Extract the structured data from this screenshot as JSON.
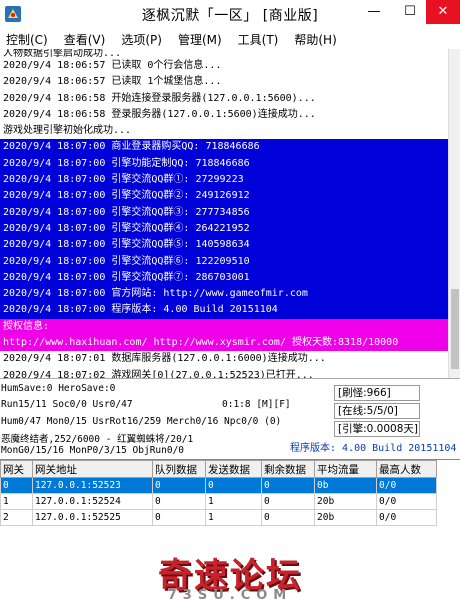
{
  "window": {
    "title": "逐枫沉默「一区」 [商业版]",
    "minimize_label": "—",
    "maximize_label": "☐",
    "close_label": "✕"
  },
  "menu": [
    "控制(C)",
    "查看(V)",
    "选项(P)",
    "管理(M)",
    "工具(T)",
    "帮助(H)"
  ],
  "log": {
    "top_cut": "人物数据引擎启动成功...",
    "lines": [
      {
        "text": "2020/9/4 18:06:57 已读取 0个行会信息...",
        "style": ""
      },
      {
        "text": "2020/9/4 18:06:57 已读取 1个城堡信息...",
        "style": ""
      },
      {
        "text": "2020/9/4 18:06:58 开始连接登录服务器(127.0.0.1:5600)...",
        "style": ""
      },
      {
        "text": "2020/9/4 18:06:58 登录服务器(127.0.0.1:5600)连接成功...",
        "style": ""
      },
      {
        "text": "游戏处理引擎初始化成功...",
        "style": ""
      },
      {
        "text": "2020/9/4 18:07:00 商业登录器购买QQ: 718846686",
        "style": "hl"
      },
      {
        "text": "2020/9/4 18:07:00 引擎功能定制QQ: 718846686",
        "style": "hl"
      },
      {
        "text": "2020/9/4 18:07:00 引擎交流QQ群①: 27299223",
        "style": "hl"
      },
      {
        "text": "2020/9/4 18:07:00 引擎交流QQ群②: 249126912",
        "style": "hl"
      },
      {
        "text": "2020/9/4 18:07:00 引擎交流QQ群③: 277734856",
        "style": "hl"
      },
      {
        "text": "2020/9/4 18:07:00 引擎交流QQ群④: 264221952",
        "style": "hl"
      },
      {
        "text": "2020/9/4 18:07:00 引擎交流QQ群⑤: 140598634",
        "style": "hl"
      },
      {
        "text": "2020/9/4 18:07:00 引擎交流QQ群⑥: 122209510",
        "style": "hl"
      },
      {
        "text": "2020/9/4 18:07:00 引擎交流QQ群⑦: 286703001",
        "style": "hl"
      },
      {
        "text": "2020/9/4 18:07:00 官方网站: http://www.gameofmir.com",
        "style": "hl"
      },
      {
        "text": "2020/9/4 18:07:00 程序版本: 4.00 Build 20151104",
        "style": "hl"
      },
      {
        "text": "授权信息:",
        "style": "pink"
      },
      {
        "text": "http://www.haxihuan.com/ http://www.xysmir.com/ 授权天数:8318/10000",
        "style": "pink"
      },
      {
        "text": "2020/9/4 18:07:01 数据库服务器(127.0.0.1:6000)连接成功...",
        "style": ""
      },
      {
        "text": "2020/9/4 18:07:02 游戏网关[0](27.0.0.1:52523)已打开...",
        "style": ""
      }
    ]
  },
  "status": {
    "line1": "HumSave:0 HeroSave:0",
    "line2": "Run15/11 Soc0/0 Usr0/47",
    "time": "0:1:8 [M][F]",
    "line3": "Hum0/47 Mon0/15 UsrRot16/259 Merch0/16 Npc0/0 (0)",
    "line4": "恶魔终结者,252/6000 - 红翼蜘蛛将/20/1",
    "line5": "MonG0/15/16 MonP0/3/15 ObjRun0/0",
    "refresh": "[刷怪:966]",
    "online": "[在线:5/5/0]",
    "engine": "[引擎:0.0008天]",
    "version": "程序版本: 4.00 Build 20151104"
  },
  "grid": {
    "columns": [
      "网关",
      "网关地址",
      "队列数据",
      "发送数据",
      "剩余数据",
      "平均流量",
      "最高人数"
    ],
    "rows": [
      [
        "0",
        "127.0.0.1:52523",
        "0",
        "0",
        "0",
        "0b",
        "0/0"
      ],
      [
        "1",
        "127.0.0.1:52524",
        "0",
        "1",
        "0",
        "20b",
        "0/0"
      ],
      [
        "2",
        "127.0.0.1:52525",
        "0",
        "1",
        "0",
        "20b",
        "0/0"
      ]
    ]
  },
  "watermark": {
    "main": "奇速论坛",
    "sub": "73SU.COM"
  }
}
